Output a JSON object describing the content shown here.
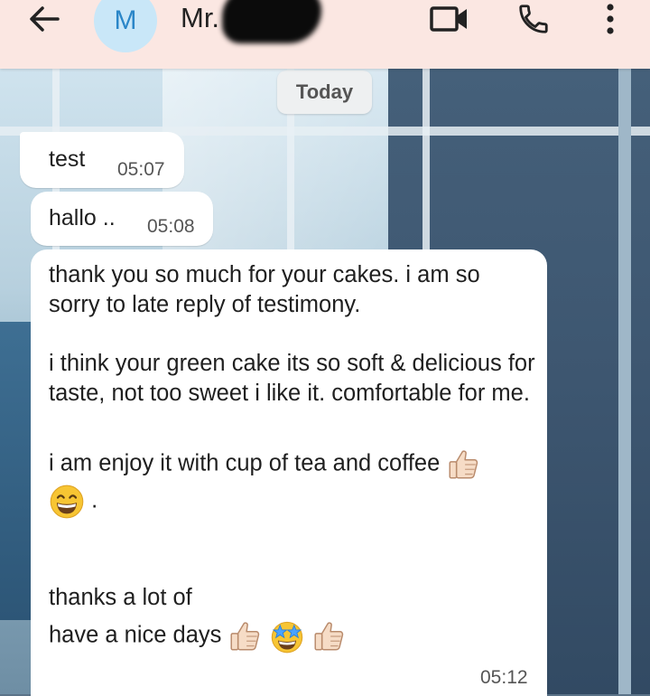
{
  "header": {
    "back_icon": "arrow-left-icon",
    "avatar_initial": "M",
    "contact_name": "Mr.",
    "video_icon": "video-camera-icon",
    "call_icon": "phone-icon",
    "menu_icon": "more-vertical-icon",
    "background_color": "#fbe7e2",
    "avatar_color": "#c9e7f8",
    "avatar_text_color": "#2a86c8"
  },
  "date_divider": "Today",
  "messages": [
    {
      "text": "test",
      "time": "05:07"
    },
    {
      "text": "hallo ..",
      "time": "05:08"
    },
    {
      "line1": "thank you so much for your cakes. i am so sorry to late reply of testimony.",
      "line2": "i think your green cake its so soft & delicious for taste, not too sweet i like it. comfortable for me.",
      "line3": "i am enjoy it with cup of tea and coffee",
      "line3_end": ".",
      "line4": "thanks a lot of",
      "line5": "have a nice days",
      "emojis": [
        "thumbs-up-icon",
        "grinning-face-icon",
        "thumbs-up-icon",
        "star-struck-face-icon",
        "thumbs-up-icon"
      ],
      "time": "05:12"
    }
  ]
}
